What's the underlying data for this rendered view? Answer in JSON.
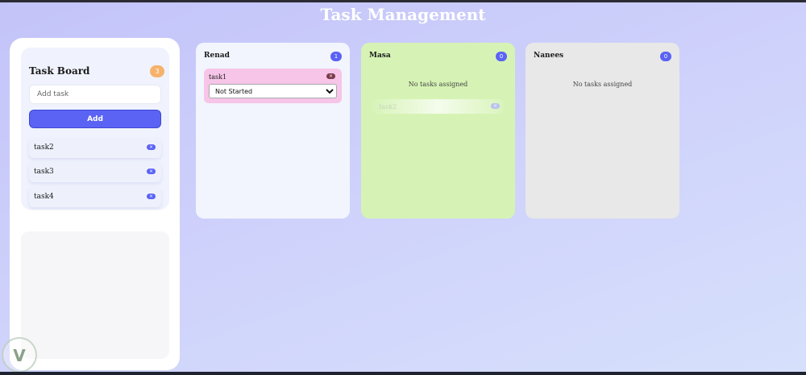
{
  "app": {
    "title": "Task Management"
  },
  "board": {
    "title": "Task Board",
    "count": "3",
    "input_placeholder": "Add task",
    "add_label": "Add",
    "tasks": [
      {
        "label": "task2",
        "remove": "×"
      },
      {
        "label": "task3",
        "remove": "×"
      },
      {
        "label": "task4",
        "remove": "×"
      }
    ]
  },
  "columns": [
    {
      "name": "Renad",
      "count": "1",
      "bg": "#f2f5fd",
      "tasks": [
        {
          "label": "task1",
          "remove": "×",
          "status": "Not Started"
        }
      ]
    },
    {
      "name": "Masa",
      "count": "0",
      "bg": "#d6f3b5",
      "empty_text": "No tasks assigned",
      "dragging": {
        "label": "task2",
        "remove": "×"
      }
    },
    {
      "name": "Nanees",
      "count": "0",
      "bg": "#e8e8e8",
      "empty_text": "No tasks assigned"
    }
  ],
  "status_options": [
    "Not Started"
  ],
  "colors": {
    "accent": "#5b63f5",
    "badge": "#f6b26b",
    "task_card": "#f6c5e8"
  },
  "watermark": {
    "icon": "v-logo-icon"
  }
}
